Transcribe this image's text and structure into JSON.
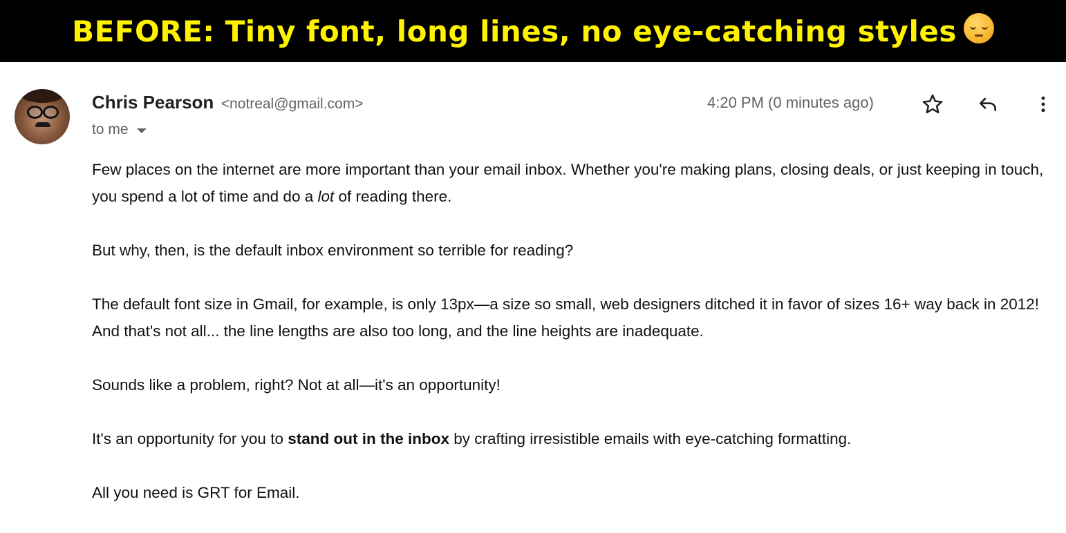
{
  "banner": {
    "title": "BEFORE: Tiny font, long lines, no eye-catching styles",
    "emoji_icon": "pensive-face-icon"
  },
  "email": {
    "sender_name": "Chris Pearson",
    "sender_email": "<notreal@gmail.com>",
    "recipient_label": "to me",
    "timestamp": "4:20 PM (0 minutes ago)",
    "actions": [
      "star-icon",
      "reply-icon",
      "more-vertical-icon"
    ],
    "body": {
      "p1": "Few places on the internet are more important than your email inbox. Whether you're making plans, closing deals, or just keeping in touch, you spend a lot of time and do a ",
      "p1_italic": "lot",
      "p1_end": " of reading there.",
      "p2": "But why, then, is the default inbox environment so terrible for reading?",
      "p3": "The default font size in Gmail, for example, is only 13px—a size so small, web designers ditched it in favor of sizes 16+ way back in 2012! And that's not all... the line lengths are also too long, and the line heights are inadequate.",
      "p4": "Sounds like a problem, right? Not at all—it's an opportunity!",
      "p5_start": "It's an opportunity for you to ",
      "p5_bold": "stand out in the inbox",
      "p5_end": " by crafting irresistible emails with eye-catching formatting.",
      "p6": "All you need is GRT for Email."
    }
  },
  "colors": {
    "banner_bg": "#000000",
    "banner_text": "#fff200",
    "secondary_text": "#5f6368"
  }
}
